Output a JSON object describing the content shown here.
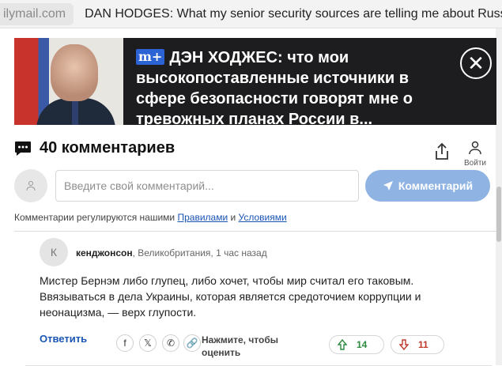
{
  "browser": {
    "url_fragment": "ilymail.com",
    "tab_title": "DAN HODGES: What my senior security sources are telling me about Russi"
  },
  "banner": {
    "logo": "m+",
    "headline": "ДЭН ХОДЖЕС: что мои высокопоставленные источники в сфере безопасности говорят мне о тревожных планах России в...",
    "close": "✕"
  },
  "comments": {
    "title": "40 комментариев",
    "login_label": "Войти",
    "input_placeholder": "Введите свой комментарий...",
    "submit_label": "Комментарий",
    "rules_prefix": "Комментарии регулируются нашими ",
    "rules_link": "Правилами",
    "rules_and": " и ",
    "terms_link": "Условиями"
  },
  "comment": {
    "avatar_letter": "К",
    "author": "кенджонсон",
    "meta": ", Великобритания, 1 час назад",
    "body": "Мистер Бернэм либо глупец, либо хочет, чтобы мир считал его таковым. Ввязываться в дела Украины, которая является средоточием коррупции и неонацизма, — верх глупости.",
    "reply": "Ответить",
    "rate_label": "Нажмите, чтобы оценить",
    "upvotes": "14",
    "downvotes": "11",
    "social": [
      "f",
      "𝕏",
      "✆",
      "🔗"
    ]
  }
}
